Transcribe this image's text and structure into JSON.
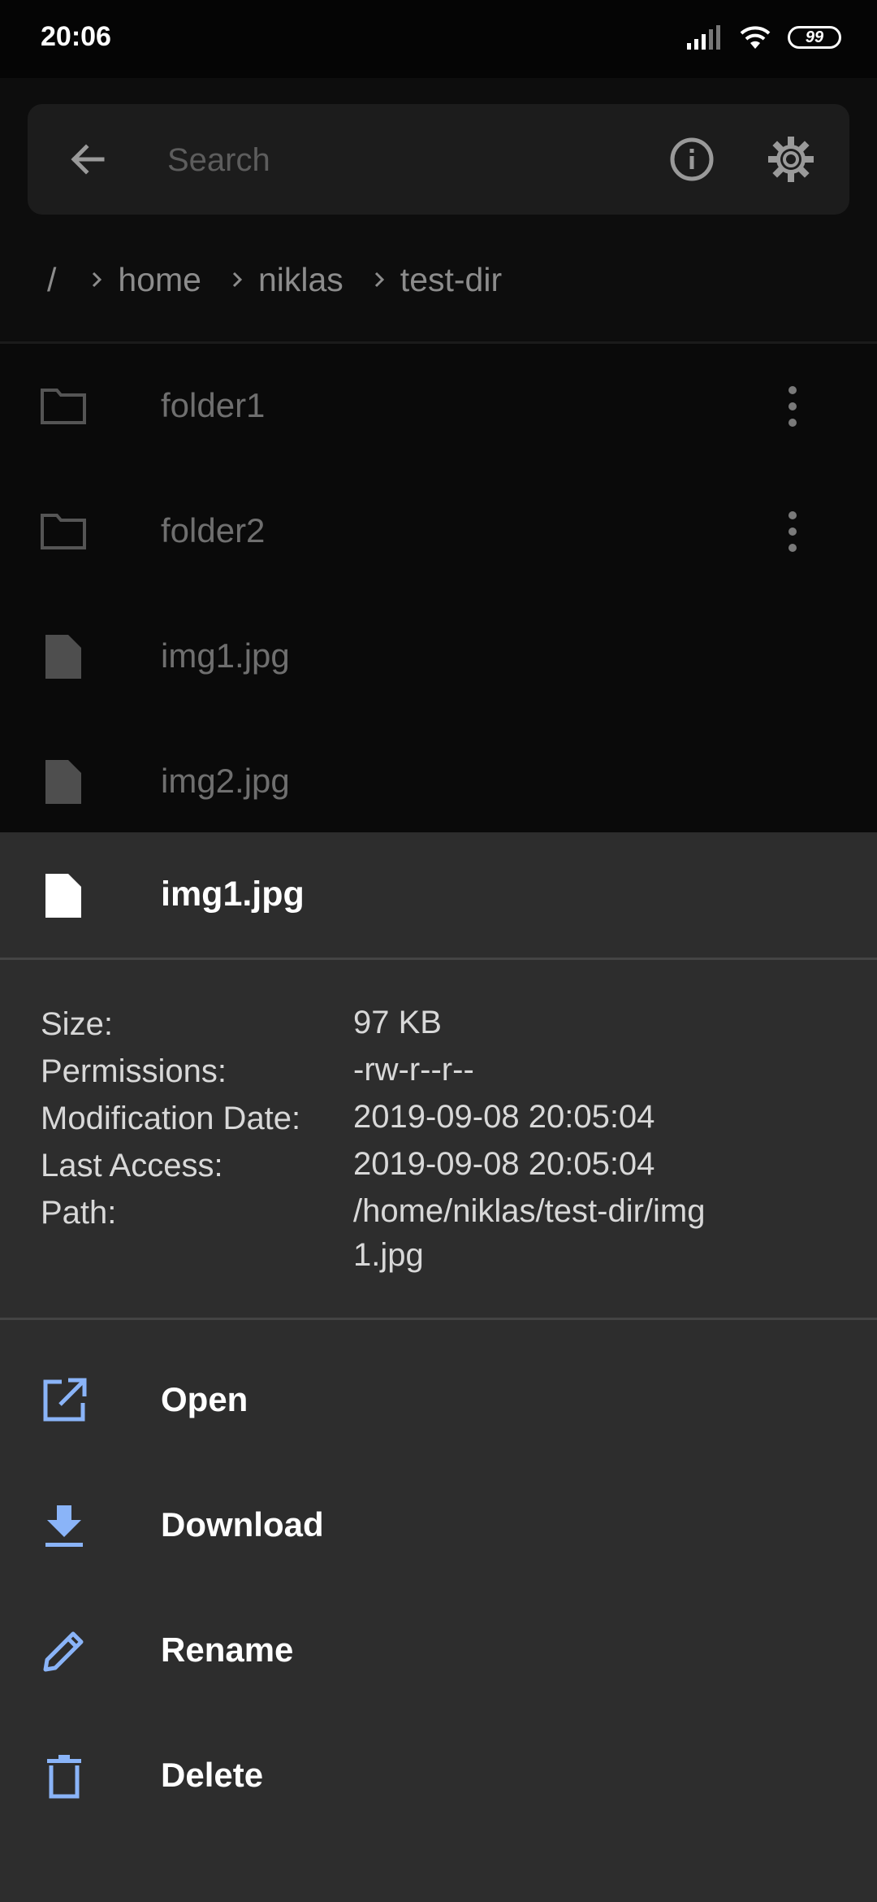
{
  "status_bar": {
    "time": "20:06",
    "battery": "99",
    "signal_icon": "signal-icon",
    "wifi_icon": "wifi-icon"
  },
  "search": {
    "placeholder": "Search",
    "back_icon": "arrow-back-icon",
    "info_icon": "info-icon",
    "settings_icon": "gear-icon"
  },
  "breadcrumb": {
    "root": "/",
    "items": [
      "home",
      "niklas",
      "test-dir"
    ]
  },
  "files": [
    {
      "name": "folder1",
      "type": "folder",
      "icon": "folder-icon",
      "has_menu": true
    },
    {
      "name": "folder2",
      "type": "folder",
      "icon": "folder-icon",
      "has_menu": true
    },
    {
      "name": "img1.jpg",
      "type": "file",
      "icon": "file-icon",
      "has_menu": false
    },
    {
      "name": "img2.jpg",
      "type": "file",
      "icon": "file-icon",
      "has_menu": false
    }
  ],
  "sheet": {
    "title": "img1.jpg",
    "icon": "file-icon",
    "details": [
      {
        "label": "Size:",
        "value": "97 KB"
      },
      {
        "label": "Permissions:",
        "value": "-rw-r--r--"
      },
      {
        "label": "Modification Date:",
        "value": "2019-09-08 20:05:04"
      },
      {
        "label": "Last Access:",
        "value": "2019-09-08 20:05:04"
      },
      {
        "label": "Path:",
        "value": "/home/niklas/test-dir/img1.jpg"
      }
    ],
    "actions": [
      {
        "label": "Open",
        "icon": "open-external-icon"
      },
      {
        "label": "Download",
        "icon": "download-icon"
      },
      {
        "label": "Rename",
        "icon": "pencil-icon"
      },
      {
        "label": "Delete",
        "icon": "trash-icon"
      }
    ]
  },
  "colors": {
    "accent": "#8ab4f8",
    "sheet_bg": "#2d2d2d",
    "list_bg": "#0a0a0a"
  }
}
